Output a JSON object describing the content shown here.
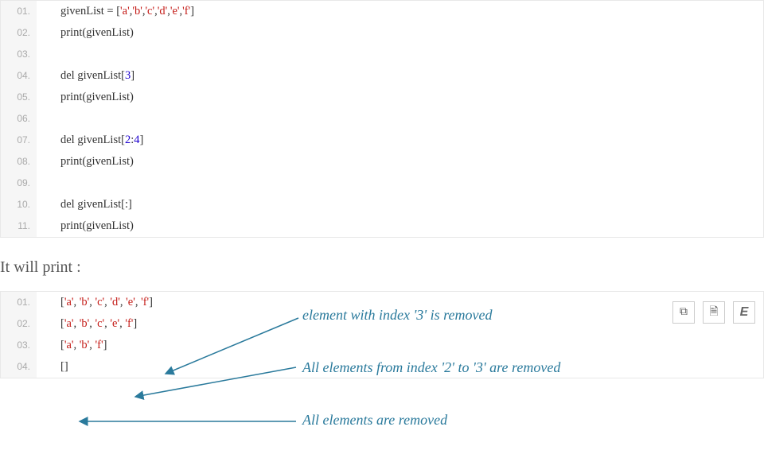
{
  "block1": {
    "lines": [
      {
        "num": "01.",
        "tokens": [
          {
            "t": "givenList = [",
            "c": "plain"
          },
          {
            "t": "'a'",
            "c": "str"
          },
          {
            "t": ",",
            "c": "plain"
          },
          {
            "t": "'b'",
            "c": "str"
          },
          {
            "t": ",",
            "c": "plain"
          },
          {
            "t": "'c'",
            "c": "str"
          },
          {
            "t": ",",
            "c": "plain"
          },
          {
            "t": "'d'",
            "c": "str"
          },
          {
            "t": ",",
            "c": "plain"
          },
          {
            "t": "'e'",
            "c": "str"
          },
          {
            "t": ",",
            "c": "plain"
          },
          {
            "t": "'f'",
            "c": "str"
          },
          {
            "t": "]",
            "c": "plain"
          }
        ]
      },
      {
        "num": "02.",
        "tokens": [
          {
            "t": "print(givenList)",
            "c": "plain"
          }
        ]
      },
      {
        "num": "03.",
        "tokens": []
      },
      {
        "num": "04.",
        "tokens": [
          {
            "t": "del givenList[",
            "c": "plain"
          },
          {
            "t": "3",
            "c": "num"
          },
          {
            "t": "]",
            "c": "plain"
          }
        ]
      },
      {
        "num": "05.",
        "tokens": [
          {
            "t": "print(givenList)",
            "c": "plain"
          }
        ]
      },
      {
        "num": "06.",
        "tokens": []
      },
      {
        "num": "07.",
        "tokens": [
          {
            "t": "del givenList[",
            "c": "plain"
          },
          {
            "t": "2",
            "c": "num"
          },
          {
            "t": ":",
            "c": "plain"
          },
          {
            "t": "4",
            "c": "num"
          },
          {
            "t": "]",
            "c": "plain"
          }
        ]
      },
      {
        "num": "08.",
        "tokens": [
          {
            "t": "print(givenList)",
            "c": "plain"
          }
        ]
      },
      {
        "num": "09.",
        "tokens": []
      },
      {
        "num": "10.",
        "tokens": [
          {
            "t": "del givenList[:]",
            "c": "plain"
          }
        ]
      },
      {
        "num": "11.",
        "tokens": [
          {
            "t": "print(givenList)",
            "c": "plain"
          }
        ]
      }
    ]
  },
  "section_title": "It will print :",
  "block2": {
    "lines": [
      {
        "num": "01.",
        "tokens": [
          {
            "t": "[",
            "c": "plain"
          },
          {
            "t": "'a'",
            "c": "str"
          },
          {
            "t": ", ",
            "c": "plain"
          },
          {
            "t": "'b'",
            "c": "str"
          },
          {
            "t": ", ",
            "c": "plain"
          },
          {
            "t": "'c'",
            "c": "str"
          },
          {
            "t": ", ",
            "c": "plain"
          },
          {
            "t": "'d'",
            "c": "str"
          },
          {
            "t": ", ",
            "c": "plain"
          },
          {
            "t": "'e'",
            "c": "str"
          },
          {
            "t": ", ",
            "c": "plain"
          },
          {
            "t": "'f'",
            "c": "str"
          },
          {
            "t": "]",
            "c": "plain"
          }
        ]
      },
      {
        "num": "02.",
        "tokens": [
          {
            "t": "[",
            "c": "plain"
          },
          {
            "t": "'a'",
            "c": "str"
          },
          {
            "t": ", ",
            "c": "plain"
          },
          {
            "t": "'b'",
            "c": "str"
          },
          {
            "t": ", ",
            "c": "plain"
          },
          {
            "t": "'c'",
            "c": "str"
          },
          {
            "t": ", ",
            "c": "plain"
          },
          {
            "t": "'e'",
            "c": "str"
          },
          {
            "t": ", ",
            "c": "plain"
          },
          {
            "t": "'f'",
            "c": "str"
          },
          {
            "t": "]",
            "c": "plain"
          }
        ]
      },
      {
        "num": "03.",
        "tokens": [
          {
            "t": "[",
            "c": "plain"
          },
          {
            "t": "'a'",
            "c": "str"
          },
          {
            "t": ", ",
            "c": "plain"
          },
          {
            "t": "'b'",
            "c": "str"
          },
          {
            "t": ", ",
            "c": "plain"
          },
          {
            "t": "'f'",
            "c": "str"
          },
          {
            "t": "]",
            "c": "plain"
          }
        ]
      },
      {
        "num": "04.",
        "tokens": [
          {
            "t": "[]",
            "c": "plain"
          }
        ]
      }
    ]
  },
  "annotations": {
    "a1": "element with index '3' is removed",
    "a2": "All elements from index '2' to '3' are removed",
    "a3": "All elements are removed"
  },
  "toolbar": {
    "btn1_glyph": "⧉",
    "btn2_glyph": "🗎",
    "btn3_glyph": "E"
  }
}
